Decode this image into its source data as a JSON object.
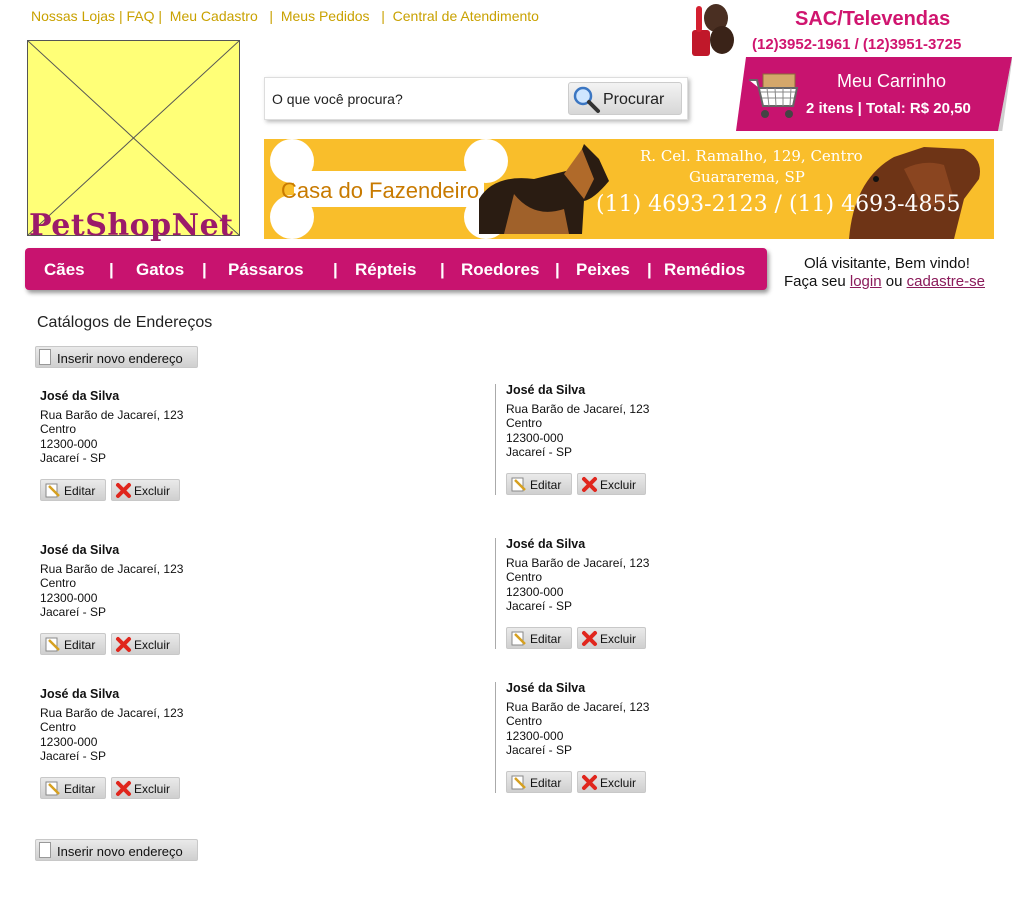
{
  "header": {
    "links": [
      "Nossas Lojas",
      "FAQ",
      "Meu Cadastro",
      "Meus Pedidos",
      "Central de Atendimento"
    ],
    "logo_text": "PetShopNet",
    "sac_title": "SAC/Televendas",
    "sac_phones": "(12)3952-1961 / (12)3951-3725"
  },
  "search": {
    "placeholder": "O que você procura?",
    "button_label": "Procurar"
  },
  "cart": {
    "title": "Meu Carrinho",
    "info": "2 itens | Total: R$ 20,50"
  },
  "banner": {
    "store_name": "Casa do Fazendeiro",
    "address_line1": "R. Cel. Ramalho, 129, Centro",
    "address_line2": "Guararema, SP",
    "phones": "(11) 4693-2123 / (11) 4693-4855"
  },
  "nav": {
    "items": [
      "Cães",
      "Gatos",
      "Pássaros",
      "Répteis",
      "Roedores",
      "Peixes",
      "Remédios"
    ]
  },
  "welcome": {
    "line1": "Olá visitante, Bem vindo!",
    "prefix": "Faça seu",
    "login": "login",
    "or": "ou",
    "signup": "cadastre-se"
  },
  "page": {
    "title": "Catálogos de Endereços",
    "add_address_label": "Inserir novo endereço",
    "edit_label": "Editar",
    "delete_label": "Excluir"
  },
  "addresses": [
    {
      "name": "José da Silva",
      "street": "Rua Barão de Jacareí, 123",
      "district": "Centro",
      "zip": "12300-000",
      "city": "Jacareí - SP"
    },
    {
      "name": "José da Silva",
      "street": "Rua Barão de Jacareí, 123",
      "district": "Centro",
      "zip": "12300-000",
      "city": "Jacareí - SP"
    },
    {
      "name": "José da Silva",
      "street": "Rua Barão de Jacareí, 123",
      "district": "Centro",
      "zip": "12300-000",
      "city": "Jacareí - SP"
    },
    {
      "name": "José da Silva",
      "street": "Rua Barão de Jacareí, 123",
      "district": "Centro",
      "zip": "12300-000",
      "city": "Jacareí - SP"
    },
    {
      "name": "José da Silva",
      "street": "Rua Barão de Jacareí, 123",
      "district": "Centro",
      "zip": "12300-000",
      "city": "Jacareí - SP"
    },
    {
      "name": "José da Silva",
      "street": "Rua Barão de Jacareí, 123",
      "district": "Centro",
      "zip": "12300-000",
      "city": "Jacareí - SP"
    }
  ],
  "colors": {
    "brand_magenta": "#c8136f",
    "link_gold": "#c9a100",
    "banner_yellow": "#f9be2b",
    "logo_placeholder": "#ffff77"
  }
}
